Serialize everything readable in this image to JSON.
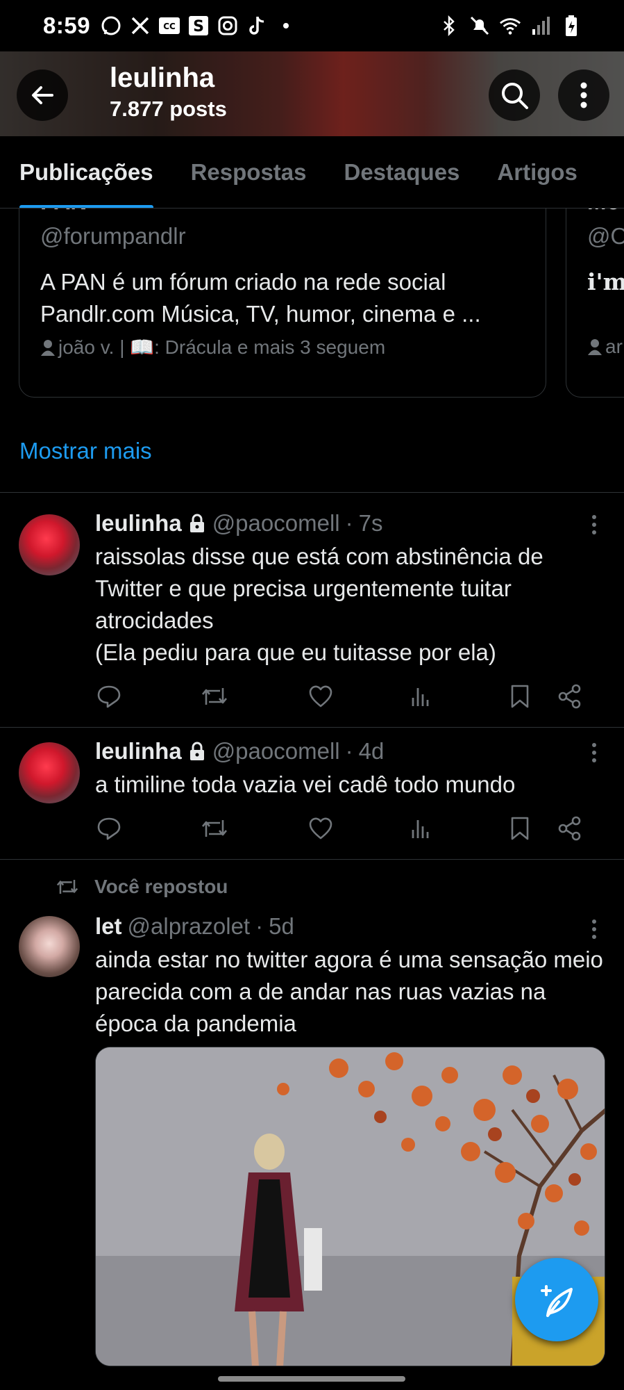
{
  "status_bar": {
    "time": "8:59",
    "left_icons": [
      "whatsapp-icon",
      "x-icon",
      "caption-icon",
      "s-app-icon",
      "instagram-icon",
      "tiktok-icon",
      "dot-icon"
    ],
    "right_icons": [
      "bluetooth-icon",
      "mute-icon",
      "wifi-icon",
      "signal-icon",
      "battery-icon"
    ]
  },
  "header": {
    "name": "leulinha",
    "posts": "7.877 posts"
  },
  "tabs": [
    {
      "label": "Publicações",
      "active": true
    },
    {
      "label": "Respostas",
      "active": false
    },
    {
      "label": "Destaques",
      "active": false
    },
    {
      "label": "Artigos",
      "active": false
    }
  ],
  "suggestions": [
    {
      "name": "PAN",
      "handle": "@forumpandlr",
      "bio": "A PAN é um fórum criado na rede social Pandlr.com Música, TV, humor, cinema e ...",
      "followed_by": "joão v. | 📖: Drácula e mais 3 seguem"
    },
    {
      "name": "Mo",
      "handle": "@O",
      "bio": "i'm",
      "followed_by": "ar"
    }
  ],
  "show_more": "Mostrar mais",
  "tweets": [
    {
      "name": "leulinha",
      "handle": "@paocomell",
      "time": "7s",
      "text": "raissolas disse que está com abstinência de Twitter e que precisa urgentemente tuitar atrocidades\n(Ela pediu para que eu tuitasse por ela)"
    },
    {
      "name": "leulinha",
      "handle": "@paocomell",
      "time": "4d",
      "text": "a timiline toda vazia vei cadê todo mundo"
    },
    {
      "repost_label": "Você repostou",
      "name": "let",
      "handle": "@alprazolet",
      "time": "5d",
      "text": "ainda estar no twitter agora é uma sensação meio parecida com a de andar nas ruas vazias na época da pandemia"
    }
  ],
  "colors": {
    "accent": "#1d9bf0",
    "secondary_text": "#71767b",
    "border": "#2f3336",
    "background": "#000000"
  }
}
